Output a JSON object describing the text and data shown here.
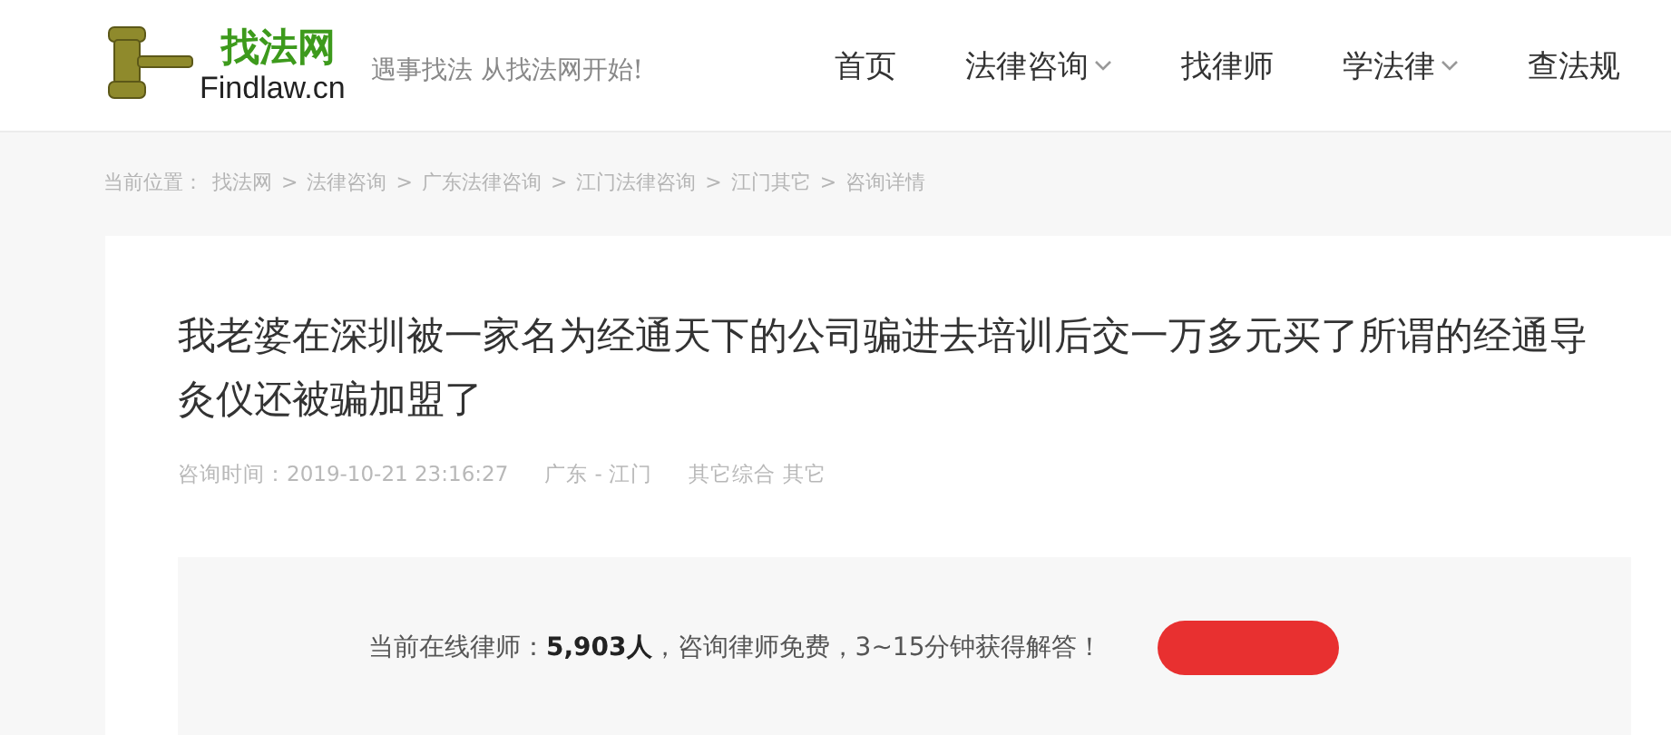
{
  "logo": {
    "name": "找法网",
    "domain": "Findlaw.cn",
    "slogan": "遇事找法 从找法网开始!"
  },
  "nav": [
    {
      "label": "首页",
      "dropdown": false
    },
    {
      "label": "法律咨询",
      "dropdown": true
    },
    {
      "label": "找律师",
      "dropdown": false
    },
    {
      "label": "学法律",
      "dropdown": true
    },
    {
      "label": "查法规",
      "dropdown": false
    }
  ],
  "breadcrumb": {
    "label": "当前位置：",
    "items": [
      "找法网",
      "法律咨询",
      "广东法律咨询",
      "江门法律咨询",
      "江门其它",
      "咨询详情"
    ],
    "separator": ">"
  },
  "question": {
    "title": "我老婆在深圳被一家名为经通天下的公司骗进去培训后交一万多元买了所谓的经通导灸仪还被骗加盟了",
    "time": "咨询时间：2019-10-21 23:16:27",
    "region": "广东 - 江门",
    "category": "其它综合 其它"
  },
  "online": {
    "text": "当前在线律师：**5,903人**，咨询律师免费，3~15分钟获得解答！"
  }
}
